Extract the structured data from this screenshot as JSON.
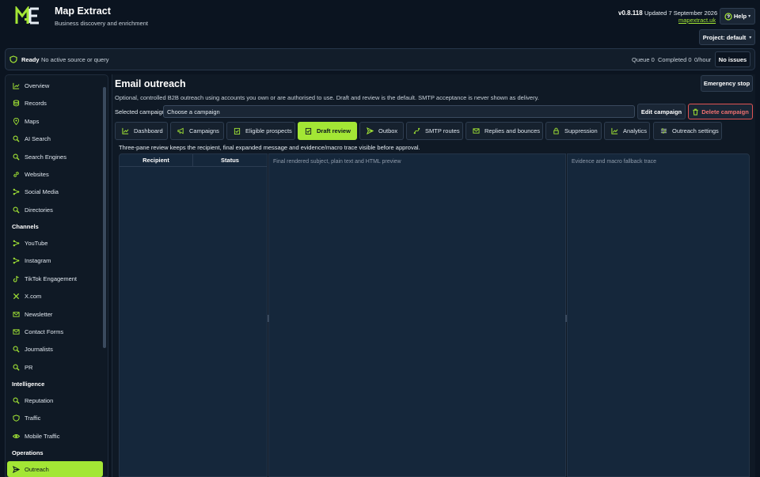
{
  "header": {
    "title": "Map Extract",
    "subtitle": "Business discovery and enrichment",
    "version": "v0.8.118",
    "updated": "Updated 7 September 2026",
    "site_link": "mapextract.uk",
    "help_label": "Help",
    "project_label": "Project: default",
    "logo_icon": "map-extract-logo"
  },
  "status": {
    "state": "Ready",
    "message": "No active source or query",
    "queue": "Queue 0",
    "completed": "Completed 0",
    "rate": "0/hour",
    "issues": "No issues"
  },
  "sidebar": {
    "items": [
      {
        "label": "Overview",
        "icon": "chart-line-icon"
      },
      {
        "label": "Records",
        "icon": "database-icon"
      },
      {
        "label": "Maps",
        "icon": "map-pin-icon"
      },
      {
        "label": "AI Search",
        "icon": "search-icon"
      },
      {
        "label": "Search Engines",
        "icon": "search-icon"
      },
      {
        "label": "Websites",
        "icon": "link-icon"
      },
      {
        "label": "Social Media",
        "icon": "share-icon"
      },
      {
        "label": "Directories",
        "icon": "search-icon"
      }
    ],
    "section_channels": "Channels",
    "channels": [
      {
        "label": "YouTube",
        "icon": "share-icon"
      },
      {
        "label": "Instagram",
        "icon": "share-icon"
      },
      {
        "label": "TikTok Engagement",
        "icon": "tiktok-icon"
      },
      {
        "label": "X.com",
        "icon": "x-icon"
      },
      {
        "label": "Newsletter",
        "icon": "mail-icon"
      },
      {
        "label": "Contact Forms",
        "icon": "contact-form-icon"
      },
      {
        "label": "Journalists",
        "icon": "search-icon"
      },
      {
        "label": "PR",
        "icon": "search-icon"
      }
    ],
    "section_intelligence": "Intelligence",
    "intelligence": [
      {
        "label": "Reputation",
        "icon": "search-icon"
      },
      {
        "label": "Traffic",
        "icon": "shield-icon"
      },
      {
        "label": "Mobile Traffic",
        "icon": "eye-icon"
      }
    ],
    "section_operations": "Operations",
    "operations": [
      {
        "label": "Outreach",
        "icon": "send-icon",
        "active": true
      }
    ]
  },
  "main": {
    "title": "Email outreach",
    "description": "Optional, controlled B2B outreach using accounts you own or are authorised to use. Draft and review is the default. SMTP acceptance is never shown as delivery.",
    "emergency_label": "Emergency stop",
    "selected_label": "Selected campaign",
    "selected_value": "Choose a campaign",
    "edit_label": "Edit campaign",
    "delete_label": "Delete campaign",
    "tabs": [
      {
        "label": "Dashboard",
        "icon": "chart-line-icon"
      },
      {
        "label": "Campaigns",
        "icon": "megaphone-icon"
      },
      {
        "label": "Eligible prospects",
        "icon": "clipboard-check-icon"
      },
      {
        "label": "Draft review",
        "icon": "clipboard-check-icon",
        "active": true
      },
      {
        "label": "Outbox",
        "icon": "send-icon"
      },
      {
        "label": "SMTP routes",
        "icon": "route-icon"
      },
      {
        "label": "Replies and bounces",
        "icon": "mail-icon"
      },
      {
        "label": "Suppression",
        "icon": "lock-icon"
      },
      {
        "label": "Analytics",
        "icon": "chart-line-icon"
      },
      {
        "label": "Outreach settings",
        "icon": "sliders-icon"
      }
    ],
    "tab_description": "Three-pane review keeps the recipient, final expanded message and evidence/macro trace visible before approval.",
    "table_headers": {
      "recipient": "Recipient",
      "status": "Status"
    },
    "preview_label": "Final rendered subject, plain text and HTML preview",
    "trace_label": "Evidence and macro fallback trace"
  },
  "colors": {
    "accent": "#a3e635",
    "background": "#0b1420",
    "panel": "#15273b",
    "danger": "#e05353"
  }
}
